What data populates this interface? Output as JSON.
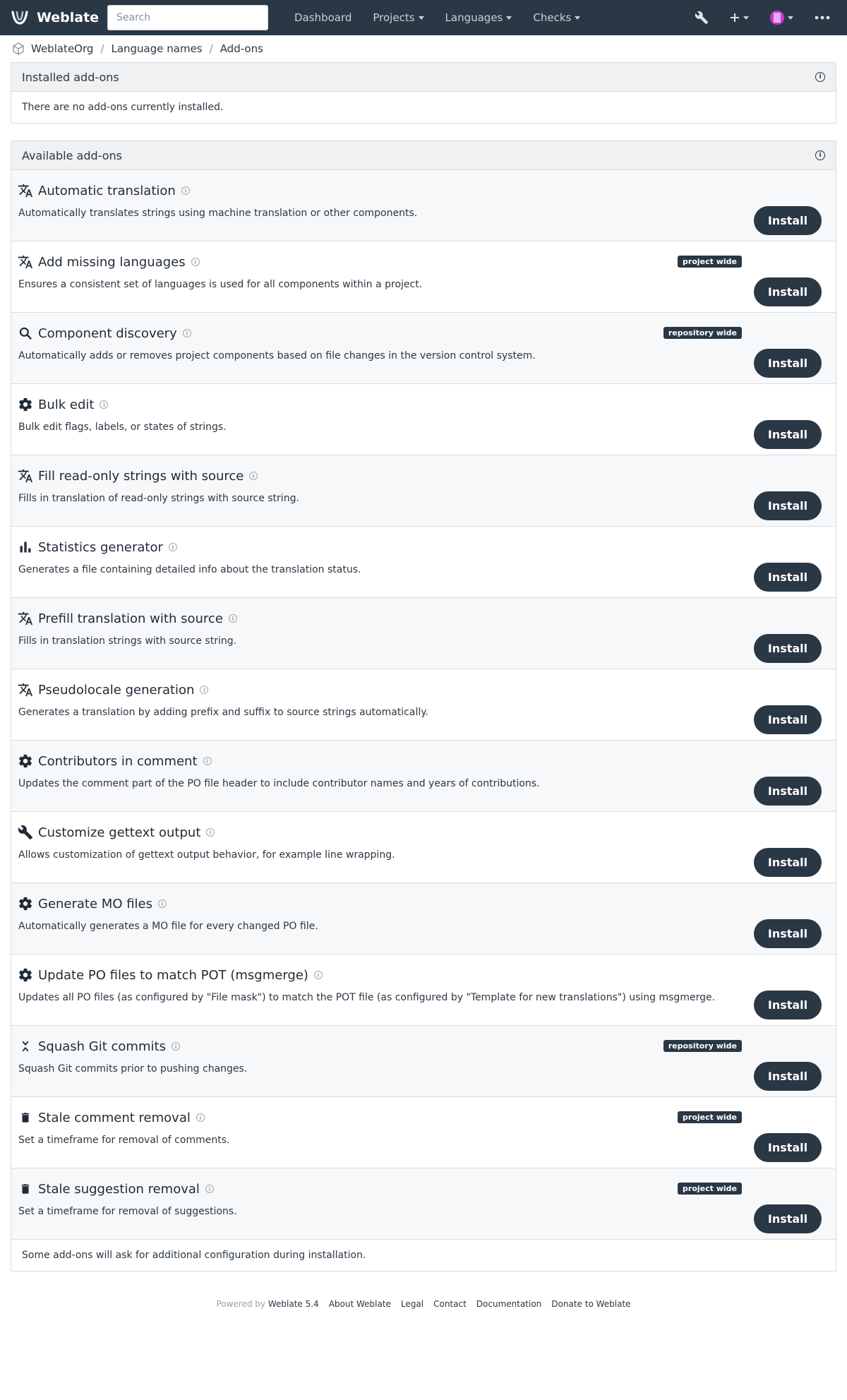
{
  "navbar": {
    "brand": "Weblate",
    "search_placeholder": "Search",
    "links": [
      "Dashboard",
      "Projects",
      "Languages",
      "Checks"
    ]
  },
  "breadcrumb": [
    "WeblateOrg",
    "Language names",
    "Add-ons"
  ],
  "installed": {
    "title": "Installed add-ons",
    "empty_text": "There are no add-ons currently installed."
  },
  "available": {
    "title": "Available add-ons",
    "install_label": "Install",
    "addons": [
      {
        "name": "Automatic translation",
        "desc": "Automatically translates strings using machine translation or other components.",
        "badge": "",
        "icon": "translate-icon"
      },
      {
        "name": "Add missing languages",
        "desc": "Ensures a consistent set of languages is used for all components within a project.",
        "badge": "project wide",
        "icon": "translate-icon"
      },
      {
        "name": "Component discovery",
        "desc": "Automatically adds or removes project components based on file changes in the version control system.",
        "badge": "repository wide",
        "icon": "search-icon"
      },
      {
        "name": "Bulk edit",
        "desc": "Bulk edit flags, labels, or states of strings.",
        "badge": "",
        "icon": "gear-icon"
      },
      {
        "name": "Fill read-only strings with source",
        "desc": "Fills in translation of read-only strings with source string.",
        "badge": "",
        "icon": "translate-icon"
      },
      {
        "name": "Statistics generator",
        "desc": "Generates a file containing detailed info about the translation status.",
        "badge": "",
        "icon": "chart-icon"
      },
      {
        "name": "Prefill translation with source",
        "desc": "Fills in translation strings with source string.",
        "badge": "",
        "icon": "translate-icon"
      },
      {
        "name": "Pseudolocale generation",
        "desc": "Generates a translation by adding prefix and suffix to source strings automatically.",
        "badge": "",
        "icon": "translate-icon"
      },
      {
        "name": "Contributors in comment",
        "desc": "Updates the comment part of the PO file header to include contributor names and years of contributions.",
        "badge": "",
        "icon": "gear-icon"
      },
      {
        "name": "Customize gettext output",
        "desc": "Allows customization of gettext output behavior, for example line wrapping.",
        "badge": "",
        "icon": "wrench-icon"
      },
      {
        "name": "Generate MO files",
        "desc": "Automatically generates a MO file for every changed PO file.",
        "badge": "",
        "icon": "gear-icon"
      },
      {
        "name": "Update PO files to match POT (msgmerge)",
        "desc": "Updates all PO files (as configured by \"File mask\") to match the POT file (as configured by \"Template for new translations\") using msgmerge.",
        "badge": "",
        "icon": "gear-icon"
      },
      {
        "name": "Squash Git commits",
        "desc": "Squash Git commits prior to pushing changes.",
        "badge": "repository wide",
        "icon": "squash-icon"
      },
      {
        "name": "Stale comment removal",
        "desc": "Set a timeframe for removal of comments.",
        "badge": "project wide",
        "icon": "trash-icon"
      },
      {
        "name": "Stale suggestion removal",
        "desc": "Set a timeframe for removal of suggestions.",
        "badge": "project wide",
        "icon": "trash-icon"
      }
    ],
    "footer_note": "Some add-ons will ask for additional configuration during installation."
  },
  "footer": {
    "powered_by": "Powered by",
    "version": "Weblate 5.4",
    "links": [
      "About Weblate",
      "Legal",
      "Contact",
      "Documentation",
      "Donate to Weblate"
    ]
  }
}
